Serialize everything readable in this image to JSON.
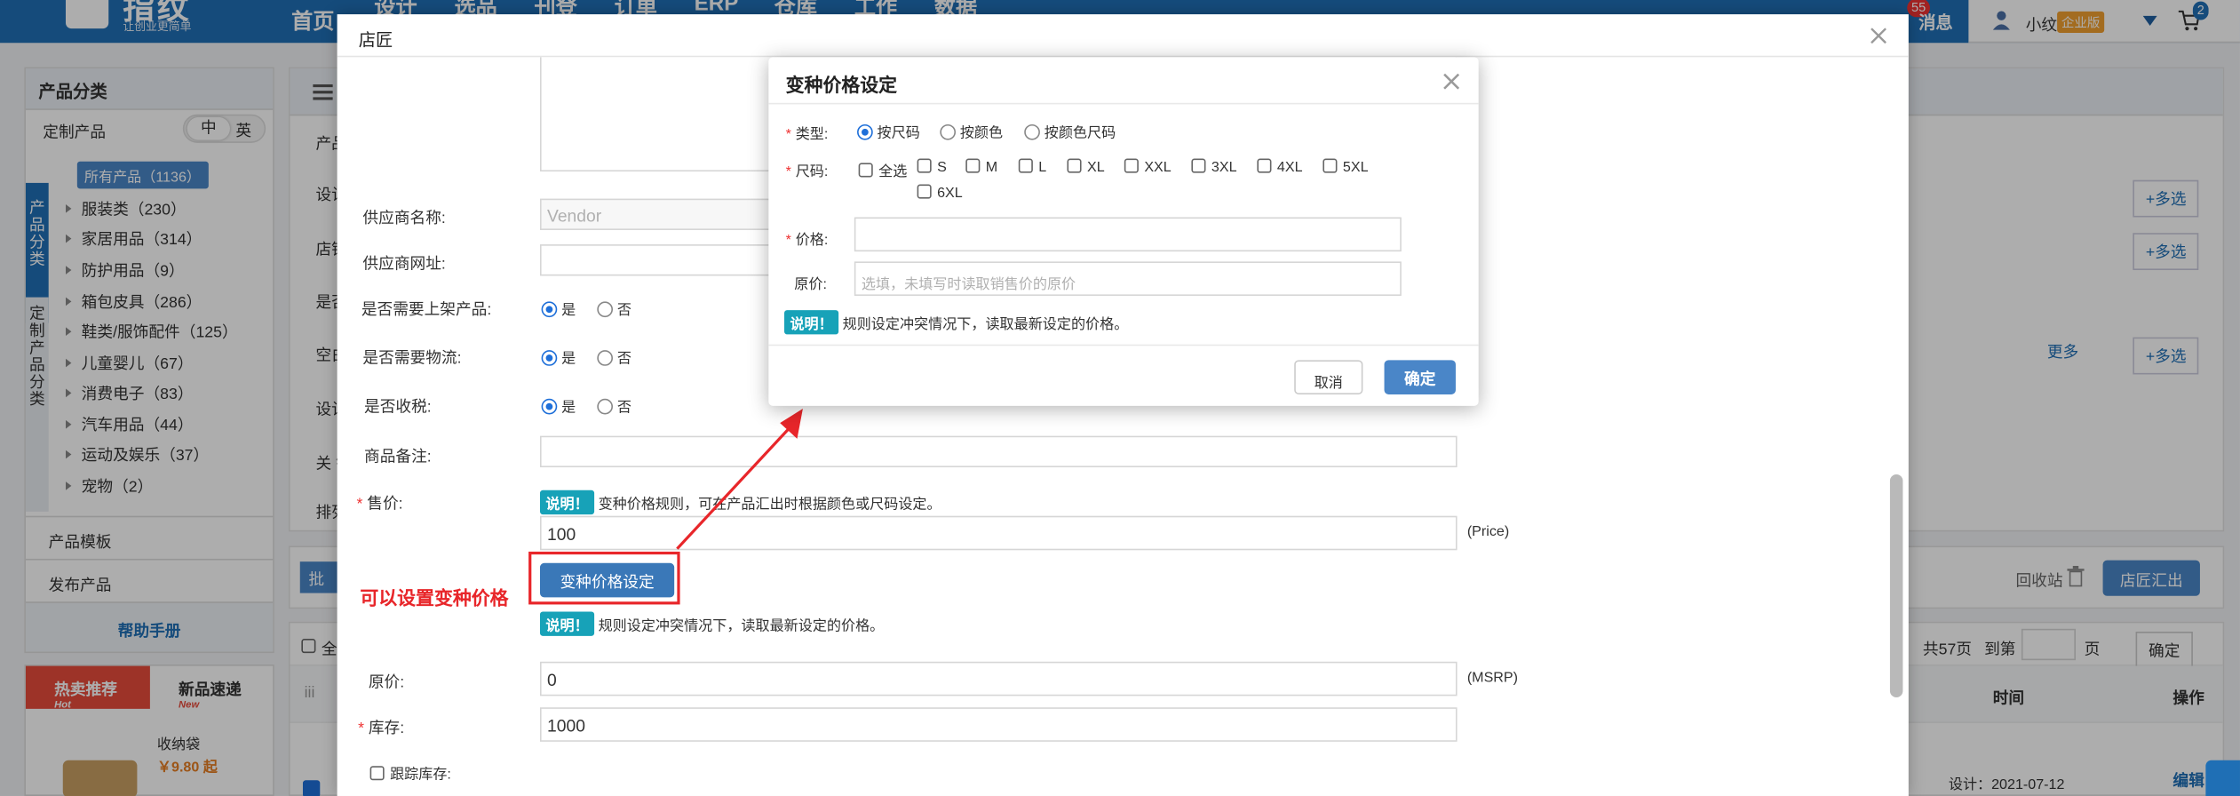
{
  "nav": {
    "brand": "指纹",
    "brand_sub": "让创业更简单",
    "items": [
      "首页",
      "设计",
      "选品",
      "刊登",
      "订单",
      "ERP",
      "仓库",
      "工作",
      "数据"
    ],
    "msg_count": "55",
    "msg_label": "消息",
    "user": "小纹",
    "badge": "企业版",
    "cart_count": "2"
  },
  "sidebar": {
    "title": "产品分类",
    "custom": "定制产品",
    "lang": [
      "中",
      "英"
    ],
    "vtab1": "产品分类",
    "vtab2": "定制产品分类",
    "all": "所有产品（1136）",
    "cats": [
      "服装类（230）",
      "家居用品（314）",
      "防护用品（9）",
      "箱包皮具（286）",
      "鞋类/服饰配件（125）",
      "儿童婴儿（67）",
      "消费电子（83）",
      "汽车用品（44）",
      "运动及娱乐（37）",
      "宠物（2）"
    ],
    "template": "产品模板",
    "publish": "发布产品",
    "help": "帮助手册",
    "hot": "热卖推荐",
    "hot_tag": "Hot",
    "new": "新品速递",
    "new_tag": "New",
    "prod_name": "收纳袋",
    "prod_price": "￥9.80 起"
  },
  "main": {
    "multi": "+多选",
    "more": "更多",
    "recycle": "回收站",
    "export": "店匠汇出",
    "pages": "共57页",
    "goto": "到第",
    "page_unit": "页",
    "confirm": "确定",
    "col_time": "时间",
    "col_op": "操作",
    "design_date": "设计：2021-07-12",
    "edit": "编辑",
    "all_sel": "全",
    "bulk": "批",
    "row_labels": [
      "产品",
      "设计",
      "店铺",
      "是否",
      "空白",
      "设计",
      "关 键",
      "排列"
    ]
  },
  "shop": {
    "title": "店匠",
    "vendor_label": "供应商名称:",
    "vendor_ph": "Vendor",
    "vendor_url_label": "供应商网址:",
    "publish_label": "是否需要上架产品:",
    "ship_label": "是否需要物流:",
    "tax_label": "是否收税:",
    "yes": "是",
    "no": "否",
    "remark_label": "商品备注:",
    "price_label": "售价:",
    "price_note": "变种价格规则，可在产品汇出时根据颜色或尺码设定。",
    "price_value": "100",
    "price_unit": "(Price)",
    "variant_btn": "变种价格设定",
    "variant_note": "规则设定冲突情况下，读取最新设定的价格。",
    "msrp_label": "原价:",
    "msrp_value": "0",
    "msrp_unit": "(MSRP)",
    "stock_label": "库存:",
    "stock_value": "1000",
    "track_label": "跟踪库存:",
    "tag": "说明！"
  },
  "annotation": "可以设置变种价格",
  "dialog": {
    "title": "变种价格设定",
    "type_label": "类型:",
    "types": [
      "按尺码",
      "按颜色",
      "按颜色尺码"
    ],
    "size_label": "尺码:",
    "sizes": [
      "全选",
      "S",
      "M",
      "L",
      "XL",
      "XXL",
      "3XL",
      "4XL",
      "5XL",
      "6XL"
    ],
    "price_label": "价格:",
    "orig_label": "原价:",
    "orig_ph": "选填，未填写时读取销售价的原价",
    "tag": "说明！",
    "note": "规则设定冲突情况下，读取最新设定的价格。",
    "cancel": "取消",
    "ok": "确定"
  },
  "colors": {
    "nav": "#1f6fb5",
    "accent": "#4a86c8",
    "tag": "#17a2b8",
    "annotation": "#e8262a",
    "hot": "#e74c3c"
  }
}
